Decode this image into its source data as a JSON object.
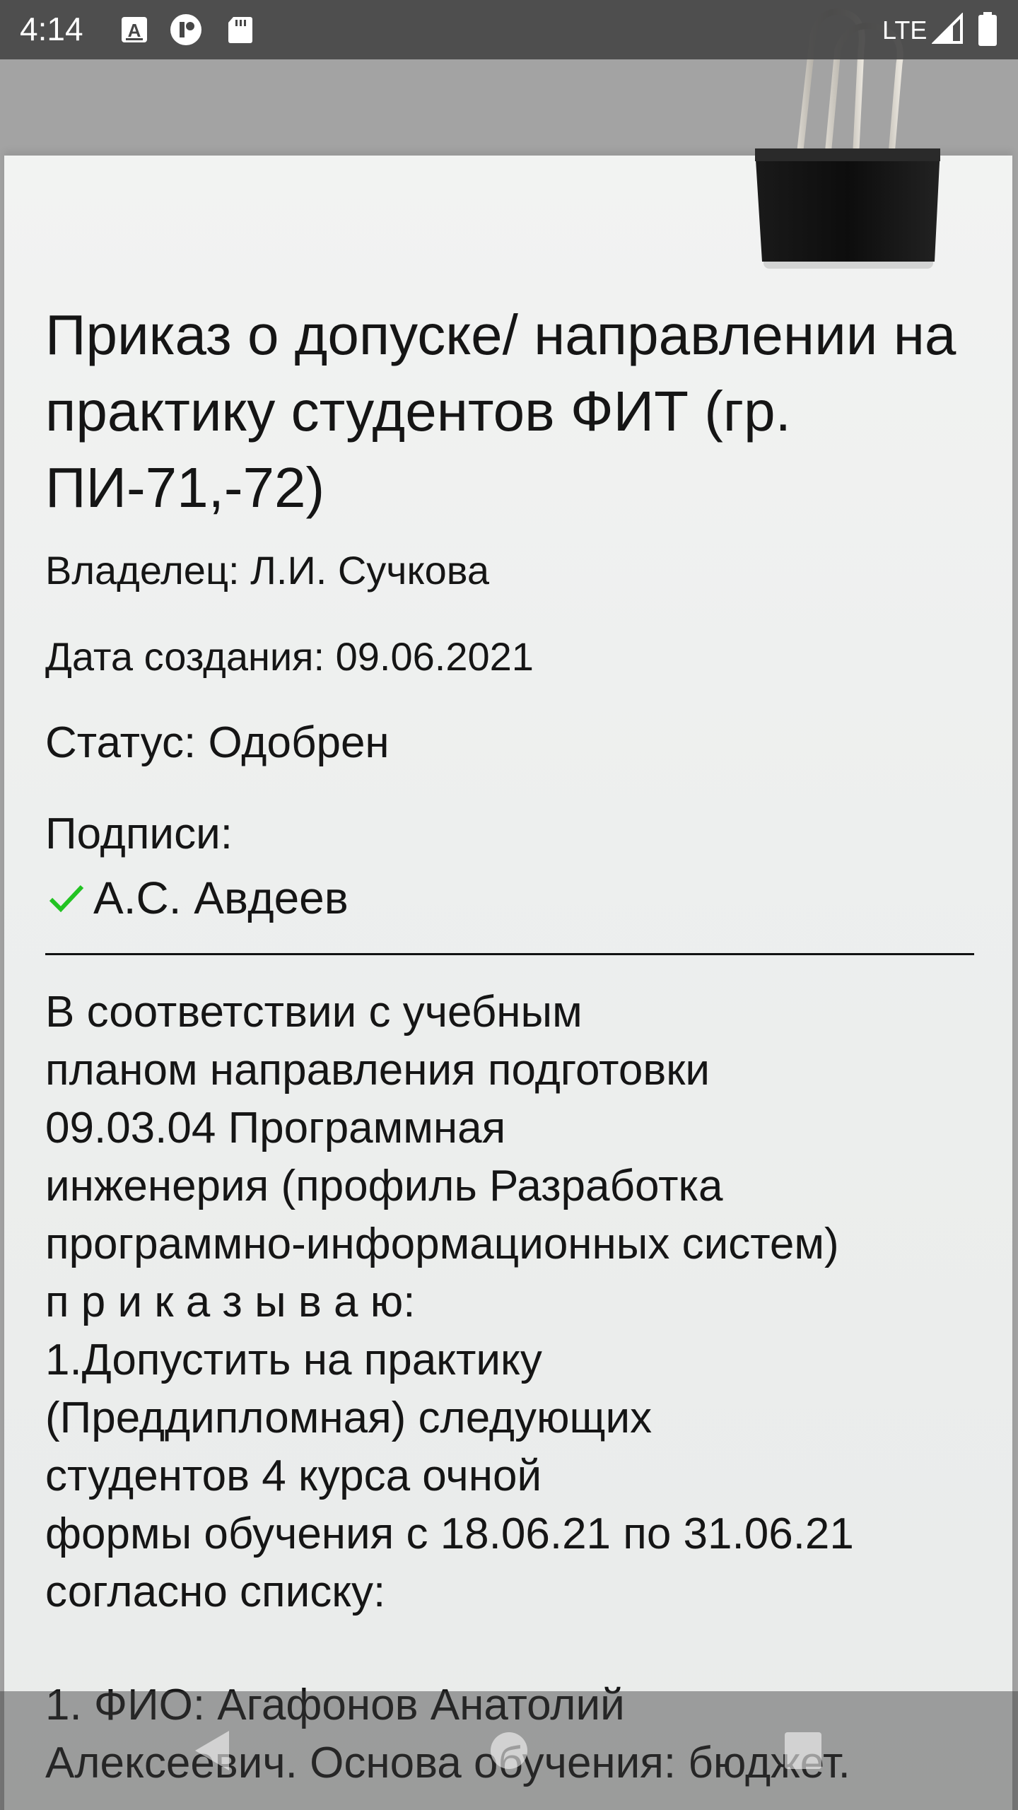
{
  "status_bar": {
    "time": "4:14",
    "network": "LTE",
    "icons": [
      "a-notification-icon",
      "vpn-icon",
      "sd-card-icon",
      "signal-icon",
      "battery-icon"
    ]
  },
  "document": {
    "title": "Приказ о допуске/ направлении на практику студентов ФИТ (гр. ПИ-71,-72)",
    "owner": "Владелец: Л.И. Сучкова",
    "created": "Дата создания: 09.06.2021",
    "status": "Статус: Одобрен",
    "signatures_label": "Подписи:",
    "signatures": [
      {
        "name": "А.С. Авдеев",
        "signed": true
      }
    ],
    "body": "В соответствии с учебным\nпланом направления подготовки\n09.03.04 Программная\nинженерия (профиль Разработка\nпрограммно-информационных систем)\nп р и к а з ы в а ю:\n1.Допустить на практику\n(Преддипломная) следующих\nстудентов 4 курса очной\nформы обучения с 18.06.21 по 31.06.21\nсогласно списку:",
    "list_item": "1. ФИО: Агафонов Анатолий\nАлексеевич. Основа обучения: бюджет."
  },
  "colors": {
    "check": "#22c322",
    "status_bar": "#464646"
  },
  "nav_bar": {
    "buttons": [
      "back-button",
      "home-button",
      "recents-button"
    ]
  }
}
